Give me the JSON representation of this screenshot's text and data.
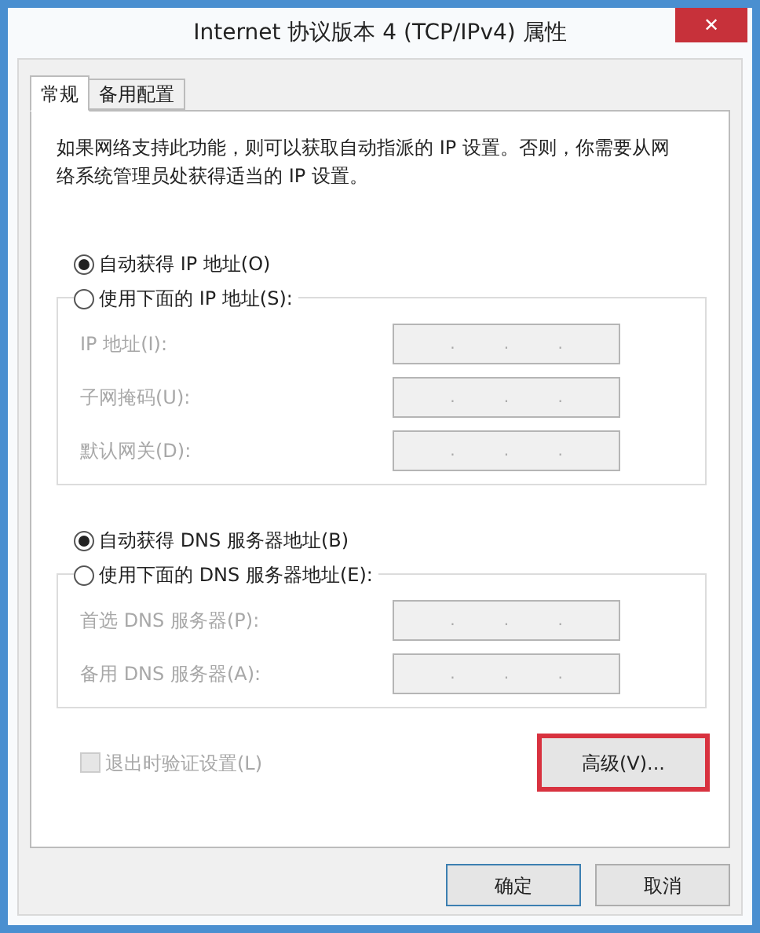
{
  "window": {
    "title": "Internet 协议版本 4 (TCP/IPv4) 属性",
    "close": "✕"
  },
  "tabs": [
    {
      "label": "常规",
      "selected": true
    },
    {
      "label": "备用配置",
      "selected": false
    }
  ],
  "description": "如果网络支持此功能，则可以获取自动指派的 IP 设置。否则，你需要从网络系统管理员处获得适当的 IP 设置。",
  "sections": [
    {
      "auto": {
        "label": "自动获得 IP 地址(O)",
        "selected": true
      },
      "manual": {
        "label": "使用下面的 IP 地址(S):",
        "selected": false
      },
      "fields": [
        {
          "label": "IP 地址(I):",
          "dots": [
            ".",
            ".",
            "."
          ],
          "disabled": true
        },
        {
          "label": "子网掩码(U):",
          "dots": [
            ".",
            ".",
            "."
          ],
          "disabled": true
        },
        {
          "label": "默认网关(D):",
          "dots": [
            ".",
            ".",
            "."
          ],
          "disabled": true
        }
      ]
    },
    {
      "auto": {
        "label": "自动获得 DNS 服务器地址(B)",
        "selected": true
      },
      "manual": {
        "label": "使用下面的 DNS 服务器地址(E):",
        "selected": false
      },
      "fields": [
        {
          "label": "首选 DNS 服务器(P):",
          "dots": [
            ".",
            ".",
            "."
          ],
          "disabled": true
        },
        {
          "label": "备用 DNS 服务器(A):",
          "dots": [
            ".",
            ".",
            "."
          ],
          "disabled": true
        }
      ]
    }
  ],
  "validate": {
    "label": "退出时验证设置(L)",
    "checked": false,
    "disabled": true
  },
  "advanced": {
    "label": "高级(V)...",
    "highlighted": true
  },
  "buttons": [
    {
      "label": "确定",
      "default": true
    },
    {
      "label": "取消",
      "default": false
    }
  ]
}
